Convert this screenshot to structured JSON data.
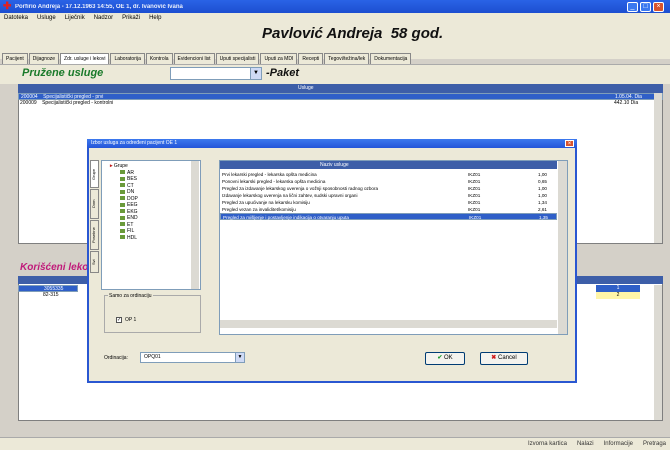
{
  "window": {
    "title": "Porfirio Andreja - 17.12.1963 14:55, OE 1, dr. Ivanović Ivana",
    "minimize": "_",
    "maximize": "□",
    "close": "×"
  },
  "menu": [
    "Datoteka",
    "Usluge",
    "Liječnik",
    "Nadzor",
    "Prikaži",
    "Help"
  ],
  "patient": {
    "name": "Pavlović Andreja",
    "age": "58 god."
  },
  "tabs": [
    "Pacijent",
    "Dijagnoze",
    "Zdr. usluge i lekovi",
    "Laboratorija",
    "Kontrola",
    "Evidencioni list",
    "Uputi specijalisti",
    "Uputi za MDI",
    "Recepti",
    "Tegovi/težina/lek",
    "Dokumentacija"
  ],
  "services": {
    "title": "Pružene usluge",
    "select_value": "",
    "select_arrow": "▼",
    "paket": "-Paket",
    "header": "Usluge",
    "rows": [
      {
        "code": "200004",
        "name": "Specijalistički pregled - prvi",
        "extra": "1.05.04. Dia"
      },
      {
        "code": "200009",
        "name": "Specijalistički pregled - kontrolni",
        "extra": "442.10 Dia"
      }
    ]
  },
  "drugs": {
    "title": "Korišćeni lekovi",
    "rows": [
      {
        "code": "3055335",
        "qty": "1"
      },
      {
        "code": "82-315",
        "qty": "2"
      }
    ]
  },
  "dialog": {
    "title": "Izbor usluga za određeni pacijent  OE 1",
    "close": "×",
    "vertical_tabs": [
      "Svi",
      "Posebne",
      "Dom",
      "Grupe"
    ],
    "tree_root": "Grupe",
    "tree_items": [
      "AR",
      "BES",
      "CT",
      "DN",
      "DOP",
      "EEG",
      "EKG",
      "END",
      "ET",
      "FIL",
      "HDL"
    ],
    "filter_label": "Samo za ordinaciju",
    "checkbox_label": "OP 1",
    "checkbox_mark": "✓",
    "grid_header": "Naziv usluge",
    "grid_rows": [
      {
        "name": "Prvi lekarski pregled - lekarska opšta medicina",
        "group": "IKZ01",
        "value": "1,00"
      },
      {
        "name": "Ponovni lekarski pregled - lekarska opšta medicina",
        "group": "IKZ01",
        "value": "0,65"
      },
      {
        "name": "Pregled za izdavanje lekarskog uverenja o vožnji sposobnosti radnog ozbora",
        "group": "IKZ01",
        "value": "1,00"
      },
      {
        "name": "Izdavanje lekarskog uverenja na lični zahtev, sudski upravni organi",
        "group": "IKZ01",
        "value": "1,00"
      },
      {
        "name": "Pregled za upućivanje na lekarsku komisiju",
        "group": "IKZ01",
        "value": "1,34"
      },
      {
        "name": "Pregled vezan za invaliditet/komisiju",
        "group": "IKZ01",
        "value": "2,61"
      },
      {
        "name": "Pregled za mišljenje i postavljenje indikacija o otvaranju uputa",
        "group": "IKZ01",
        "value": "1,35"
      }
    ],
    "selected_row": 6,
    "ordinacija_label": "Ordinacija:",
    "ordinacija_value": "OPQ01",
    "ok": "OK",
    "cancel": "Cancel"
  },
  "status": [
    "Izvorna kartica",
    "Nalazi",
    "Informacije",
    "Pretraga"
  ]
}
